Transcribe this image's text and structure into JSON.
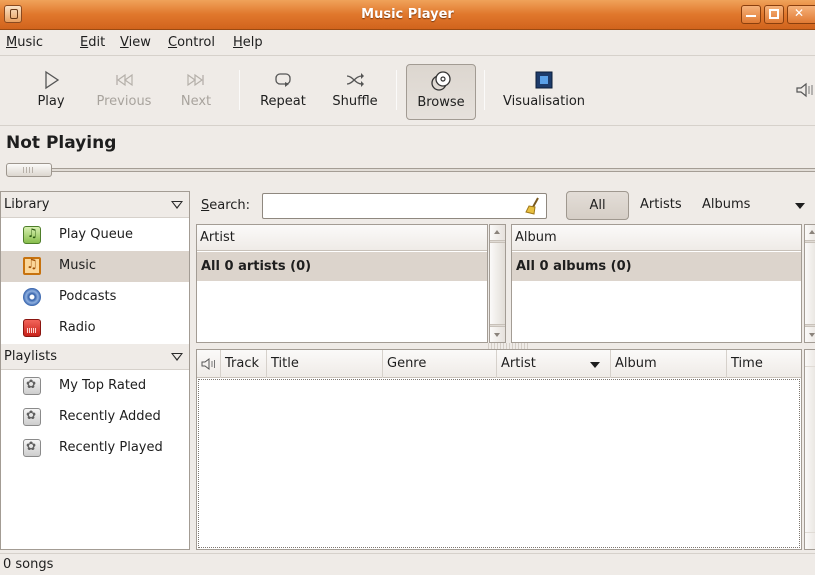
{
  "window": {
    "title": "Music Player"
  },
  "menubar": {
    "items": [
      {
        "label": "Music",
        "accel": "M",
        "rest": "usic"
      },
      {
        "label": "Edit",
        "accel": "E",
        "rest": "dit"
      },
      {
        "label": "View",
        "accel": "V",
        "rest": "iew"
      },
      {
        "label": "Control",
        "accel": "C",
        "rest": "ontrol"
      },
      {
        "label": "Help",
        "accel": "H",
        "rest": "elp"
      }
    ]
  },
  "toolbar": {
    "play": {
      "label": "Play",
      "icon": "play-icon",
      "enabled": true
    },
    "previous": {
      "label": "Previous",
      "icon": "previous-icon",
      "enabled": false
    },
    "next": {
      "label": "Next",
      "icon": "next-icon",
      "enabled": false
    },
    "repeat": {
      "label": "Repeat",
      "icon": "repeat-icon",
      "enabled": true
    },
    "shuffle": {
      "label": "Shuffle",
      "icon": "shuffle-icon",
      "enabled": true
    },
    "browse": {
      "label": "Browse",
      "icon": "browse-icon",
      "pressed": true
    },
    "visualisation": {
      "label": "Visualisation",
      "icon": "visualisation-icon",
      "enabled": true
    },
    "volume": {
      "icon": "volume-icon"
    }
  },
  "now_playing": {
    "title": "Not Playing",
    "position_fraction": 0
  },
  "sidebar": {
    "library_header": "Library",
    "library_items": [
      {
        "label": "Play Queue",
        "icon": "play-queue-icon",
        "selected": false
      },
      {
        "label": "Music",
        "icon": "music-library-icon",
        "selected": true
      },
      {
        "label": "Podcasts",
        "icon": "podcasts-icon",
        "selected": false
      },
      {
        "label": "Radio",
        "icon": "radio-icon",
        "selected": false
      }
    ],
    "playlists_header": "Playlists",
    "playlist_items": [
      {
        "label": "My Top Rated",
        "icon": "smart-playlist-icon"
      },
      {
        "label": "Recently Added",
        "icon": "smart-playlist-icon"
      },
      {
        "label": "Recently Played",
        "icon": "smart-playlist-icon"
      }
    ]
  },
  "search": {
    "label": "Search:",
    "accel": "S",
    "rest": "earch:",
    "value": "",
    "placeholder": "",
    "clear_icon": "clear-broom-icon"
  },
  "filters": {
    "all": "All",
    "artists": "Artists",
    "albums": "Albums"
  },
  "browser": {
    "artist_header": "Artist",
    "artist_all_row": "All 0 artists (0)",
    "album_header": "Album",
    "album_all_row": "All 0 albums (0)"
  },
  "tracks": {
    "columns": [
      "Track",
      "Title",
      "Genre",
      "Artist",
      "Album",
      "Time"
    ],
    "sorted_column": "Artist",
    "playing_icon": "now-playing-speaker-icon",
    "rows": []
  },
  "statusbar": {
    "text": "0 songs"
  },
  "colors": {
    "titlebar": "#e0772c",
    "selection": "#dcd4cc",
    "window_bg": "#efebe7"
  }
}
